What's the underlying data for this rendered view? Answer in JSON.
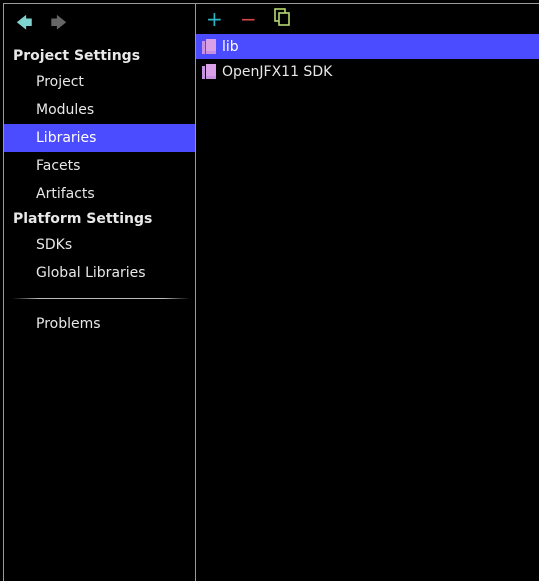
{
  "nav": {
    "back_icon": "arrow-left-icon",
    "forward_icon": "arrow-right-icon"
  },
  "sidebar": {
    "project_settings_header": "Project Settings",
    "project_items": [
      {
        "label": "Project"
      },
      {
        "label": "Modules"
      },
      {
        "label": "Libraries",
        "selected": true
      },
      {
        "label": "Facets"
      },
      {
        "label": "Artifacts"
      }
    ],
    "platform_settings_header": "Platform Settings",
    "platform_items": [
      {
        "label": "SDKs"
      },
      {
        "label": "Global Libraries"
      }
    ],
    "problems_label": "Problems"
  },
  "toolbar": {
    "add": "+",
    "remove": "−",
    "copy_icon": "copy-icon"
  },
  "libraries": [
    {
      "label": "lib",
      "selected": true
    },
    {
      "label": "OpenJFX11 SDK"
    }
  ],
  "colors": {
    "selection": "#4b4bff",
    "add": "#2ab6c8",
    "remove": "#d04545",
    "copy": "#b8d870"
  }
}
